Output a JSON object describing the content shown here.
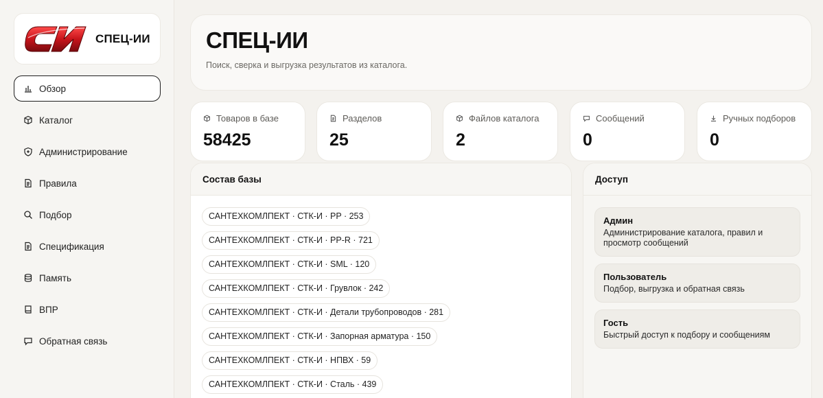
{
  "brand": {
    "name": "СПЕЦ-ИИ",
    "logo_glyph": "СИ",
    "logo_color": "#c8141b"
  },
  "sidebar": {
    "items": [
      {
        "label": "Обзор",
        "icon": "bar-chart-icon",
        "active": true
      },
      {
        "label": "Каталог",
        "icon": "box-icon",
        "active": false
      },
      {
        "label": "Администрирование",
        "icon": "shield-icon",
        "active": false
      },
      {
        "label": "Правила",
        "icon": "document-icon",
        "active": false
      },
      {
        "label": "Подбор",
        "icon": "search-icon",
        "active": false
      },
      {
        "label": "Спецификация",
        "icon": "document-icon",
        "active": false
      },
      {
        "label": "Память",
        "icon": "database-icon",
        "active": false
      },
      {
        "label": "ВПР",
        "icon": "book-icon",
        "active": false
      },
      {
        "label": "Обратная связь",
        "icon": "chat-icon",
        "active": false
      }
    ]
  },
  "hero": {
    "title": "СПЕЦ-ИИ",
    "subtitle": "Поиск, сверка и выгрузка результатов из каталога."
  },
  "stats": [
    {
      "label": "Товаров в базе",
      "value": "58425",
      "icon": "box-icon"
    },
    {
      "label": "Разделов",
      "value": "25",
      "icon": "document-icon"
    },
    {
      "label": "Файлов каталога",
      "value": "2",
      "icon": "box-icon"
    },
    {
      "label": "Сообщений",
      "value": "0",
      "icon": "chat-icon"
    },
    {
      "label": "Ручных подборов",
      "value": "0",
      "icon": "download-icon"
    }
  ],
  "composition": {
    "title": "Состав базы",
    "items": [
      "САНТЕХКОМЛПЕКТ · СТК-И · PP · 253",
      "САНТЕХКОМЛПЕКТ · СТК-И · PP-R · 721",
      "САНТЕХКОМЛПЕКТ · СТК-И · SML · 120",
      "САНТЕХКОМЛПЕКТ · СТК-И · Грувлок · 242",
      "САНТЕХКОМЛПЕКТ · СТК-И · Детали трубопроводов · 281",
      "САНТЕХКОМЛПЕКТ · СТК-И · Запорная арматура · 150",
      "САНТЕХКОМЛПЕКТ · СТК-И · НПВХ · 59",
      "САНТЕХКОМЛПЕКТ · СТК-И · Сталь · 439"
    ]
  },
  "access": {
    "title": "Доступ",
    "roles": [
      {
        "title": "Админ",
        "desc": "Администрирование каталога, правил и просмотр сообщений"
      },
      {
        "title": "Пользователь",
        "desc": "Подбор, выгрузка и обратная связь"
      },
      {
        "title": "Гость",
        "desc": "Быстрый доступ к подбору и сообщениям"
      }
    ]
  }
}
